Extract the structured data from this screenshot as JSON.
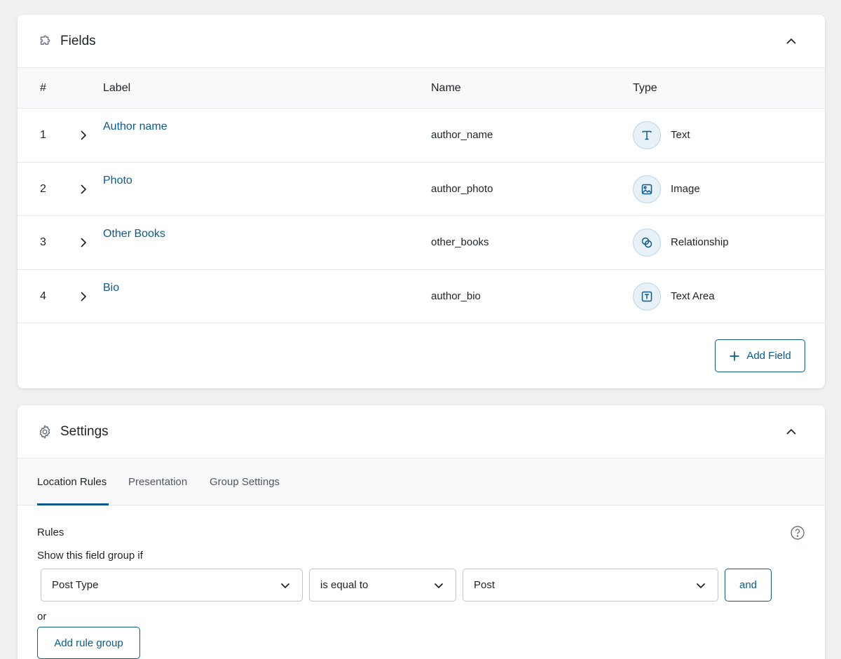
{
  "fields_panel": {
    "title": "Fields",
    "columns": {
      "num": "#",
      "label": "Label",
      "name": "Name",
      "type": "Type"
    },
    "rows": [
      {
        "num": "1",
        "label": "Author name",
        "name": "author_name",
        "type": "Text",
        "type_icon": "text-type-icon"
      },
      {
        "num": "2",
        "label": "Photo",
        "name": "author_photo",
        "type": "Image",
        "type_icon": "image-type-icon"
      },
      {
        "num": "3",
        "label": "Other Books",
        "name": "other_books",
        "type": "Relationship",
        "type_icon": "relationship-type-icon"
      },
      {
        "num": "4",
        "label": "Bio",
        "name": "author_bio",
        "type": "Text Area",
        "type_icon": "textarea-type-icon"
      }
    ],
    "add_field_label": "Add Field"
  },
  "settings_panel": {
    "title": "Settings",
    "tabs": [
      {
        "label": "Location Rules",
        "active": true
      },
      {
        "label": "Presentation",
        "active": false
      },
      {
        "label": "Group Settings",
        "active": false
      }
    ],
    "rules_title": "Rules",
    "show_if": "Show this field group if",
    "rule": {
      "param": "Post Type",
      "operator": "is equal to",
      "value": "Post"
    },
    "and_label": "and",
    "or_label": "or",
    "add_rule_group_label": "Add rule group"
  },
  "colors": {
    "accent": "#0a5a8f",
    "background": "#f0f0f1",
    "icon_bg": "#e8f1f8"
  }
}
